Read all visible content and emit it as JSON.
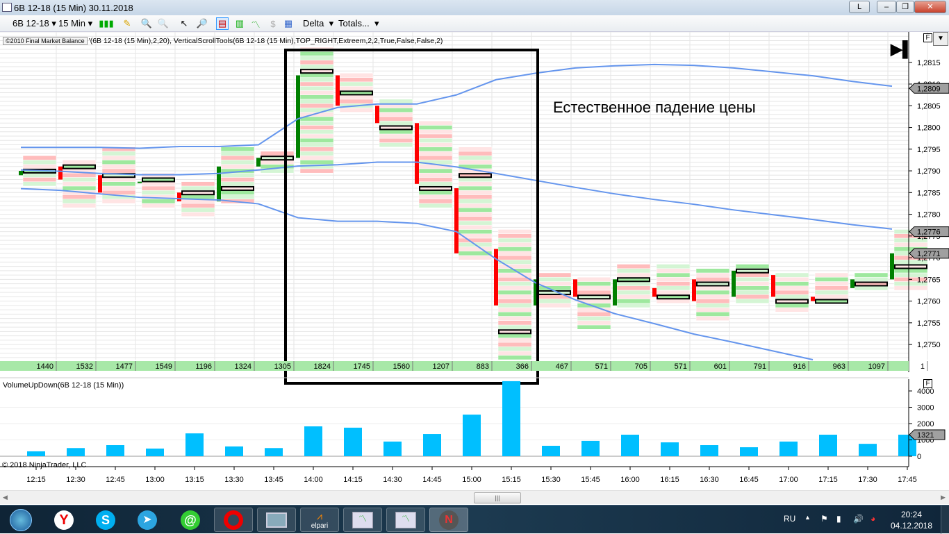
{
  "window": {
    "title": "6B 12-18 (15 Min)  30.11.2018",
    "btn_l": "L",
    "minimize": "‒",
    "restore": "❐",
    "close": "✕"
  },
  "toolbar": {
    "instrument": "6B 12-18",
    "interval": "15 Min",
    "delta": "Delta",
    "totals": "Totals..."
  },
  "indicator_label": {
    "box": "©2010 Final Market Balance",
    "text": "'(6B 12-18 (15 Min),2,20), VerticalScrollTools(6B 12-18 (15 Min),TOP_RIGHT,Extreem,2,2,True,False,False,2)"
  },
  "annotation": "Естественное падение цены",
  "panel_f": "F",
  "volume_panel_label": "VolumeUpDown(6B 12-18 (15 Min))",
  "copyright": "© 2018 NinjaTrader, LLC",
  "scroll_thumb": "|||",
  "colors": {
    "up": "#008000",
    "down": "#ff0000",
    "band": "#6495ed",
    "volume": "#00bfff",
    "cell_green": "#b8f0b8",
    "cell_red": "#ffd0d0",
    "totals_bg": "#a8e8a8"
  },
  "chart_data": {
    "type": "footprint-candlestick",
    "price_axis": {
      "ylim": [
        1.27465,
        1.2822
      ],
      "ticks": [
        "1,2815",
        "1,2810",
        "1,2805",
        "1,2800",
        "1,2795",
        "1,2790",
        "1,2785",
        "1,2780",
        "1,2775",
        "1,2770",
        "1,2765",
        "1,2760",
        "1,2755",
        "1,2750"
      ],
      "tick_values": [
        1.2815,
        1.281,
        1.2805,
        1.28,
        1.2795,
        1.279,
        1.2785,
        1.278,
        1.2775,
        1.277,
        1.2765,
        1.276,
        1.2755,
        1.275
      ],
      "markers": [
        {
          "label": "1,2809",
          "value": 1.2809
        },
        {
          "label": "1,2776",
          "value": 1.2776
        },
        {
          "label": "1,2771",
          "value": 1.2771
        }
      ]
    },
    "times": [
      "12:15",
      "12:30",
      "12:45",
      "13:00",
      "13:15",
      "13:30",
      "13:45",
      "14:00",
      "14:15",
      "14:30",
      "14:45",
      "15:00",
      "15:15",
      "15:30",
      "15:45",
      "16:00",
      "16:15",
      "16:30",
      "16:45",
      "17:00",
      "17:15",
      "17:30",
      "17:45"
    ],
    "open": [
      1.2789,
      1.2791,
      1.2789,
      1.27875,
      1.2785,
      1.2783,
      1.2791,
      1.2793,
      1.2812,
      1.2805,
      1.2801,
      1.2786,
      1.2772,
      1.2759,
      1.2765,
      1.2759,
      1.2763,
      1.2765,
      1.2761,
      1.2766,
      1.2761,
      1.2763,
      1.2765
    ],
    "close": [
      1.279,
      1.2788,
      1.2785,
      1.27875,
      1.2783,
      1.2791,
      1.2793,
      1.2812,
      1.2805,
      1.2801,
      1.2787,
      1.2771,
      1.2759,
      1.2765,
      1.2761,
      1.2765,
      1.2761,
      1.276,
      1.2767,
      1.2761,
      1.276,
      1.2765,
      1.2771
    ],
    "high": [
      1.2793,
      1.2792,
      1.2795,
      1.2789,
      1.2787,
      1.2795,
      1.2794,
      1.2818,
      1.2812,
      1.2806,
      1.2801,
      1.2795,
      1.2776,
      1.2766,
      1.2765,
      1.2768,
      1.2768,
      1.2767,
      1.2768,
      1.2766,
      1.2766,
      1.2766,
      1.2776
    ],
    "low": [
      1.2787,
      1.2782,
      1.2783,
      1.2782,
      1.278,
      1.2783,
      1.279,
      1.279,
      1.2804,
      1.2796,
      1.2782,
      1.277,
      1.2747,
      1.2759,
      1.2754,
      1.2759,
      1.276,
      1.2756,
      1.276,
      1.2758,
      1.276,
      1.2763,
      1.2763
    ],
    "poc": [
      1.279,
      1.2791,
      1.2789,
      1.2788,
      1.2785,
      1.2786,
      1.2793,
      1.2813,
      1.2808,
      1.28,
      1.2786,
      1.2789,
      1.2753,
      1.2762,
      1.2761,
      1.2765,
      1.2761,
      1.2764,
      1.2767,
      1.276,
      1.276,
      1.2764,
      1.2768
    ],
    "bands": {
      "upper": [
        1.27954,
        1.27954,
        1.27954,
        1.27952,
        1.27956,
        1.27956,
        1.2796,
        1.2802,
        1.28046,
        1.28054,
        1.28054,
        1.28075,
        1.2811,
        1.28125,
        1.28137,
        1.28142,
        1.28145,
        1.28143,
        1.28137,
        1.28128,
        1.28119,
        1.28106,
        1.28095
      ],
      "middle": [
        1.27902,
        1.27899,
        1.27894,
        1.27891,
        1.27891,
        1.27894,
        1.27902,
        1.27911,
        1.27914,
        1.2792,
        1.2792,
        1.27909,
        1.27894,
        1.27878,
        1.27862,
        1.27847,
        1.27834,
        1.27823,
        1.2781,
        1.27799,
        1.27788,
        1.27776,
        1.27766
      ],
      "lower": [
        1.27859,
        1.27855,
        1.27847,
        1.27839,
        1.27836,
        1.27833,
        1.27824,
        1.27792,
        1.27784,
        1.27784,
        1.27779,
        1.2776,
        1.27697,
        1.27642,
        1.27603,
        1.27571,
        1.27548,
        1.27524,
        1.27505,
        1.27485,
        1.27465,
        1.2745,
        1.2744
      ]
    },
    "totals": [
      "1440",
      "1532",
      "1477",
      "1549",
      "1196",
      "1324",
      "1305",
      "1824",
      "1745",
      "1560",
      "1207",
      "883",
      "366",
      "467",
      "571",
      "705",
      "571",
      "601",
      "791",
      "916",
      "963",
      "1097",
      "1"
    ],
    "volume": {
      "values": [
        300,
        500,
        680,
        470,
        1400,
        600,
        500,
        1830,
        1750,
        900,
        1360,
        2550,
        4600,
        640,
        940,
        1320,
        850,
        680,
        550,
        900,
        1320,
        760,
        1321
      ],
      "ylim": [
        0,
        4000
      ],
      "ticks": [
        "4000",
        "3000",
        "2000",
        "1000",
        "0"
      ],
      "tick_values": [
        4000,
        3000,
        2000,
        1000,
        0
      ],
      "marker": {
        "label": "1321",
        "value": 1321
      }
    }
  },
  "taskbar": {
    "apps": [
      "start",
      "yandex",
      "skype",
      "telegram",
      "at-mail",
      "opera",
      "computer",
      "elpari",
      "chart-app-1",
      "chart-app-2",
      "ninjatrader"
    ],
    "elpari_label": "elpari",
    "lang": "RU",
    "time": "20:24",
    "date": "04.12.2018"
  }
}
